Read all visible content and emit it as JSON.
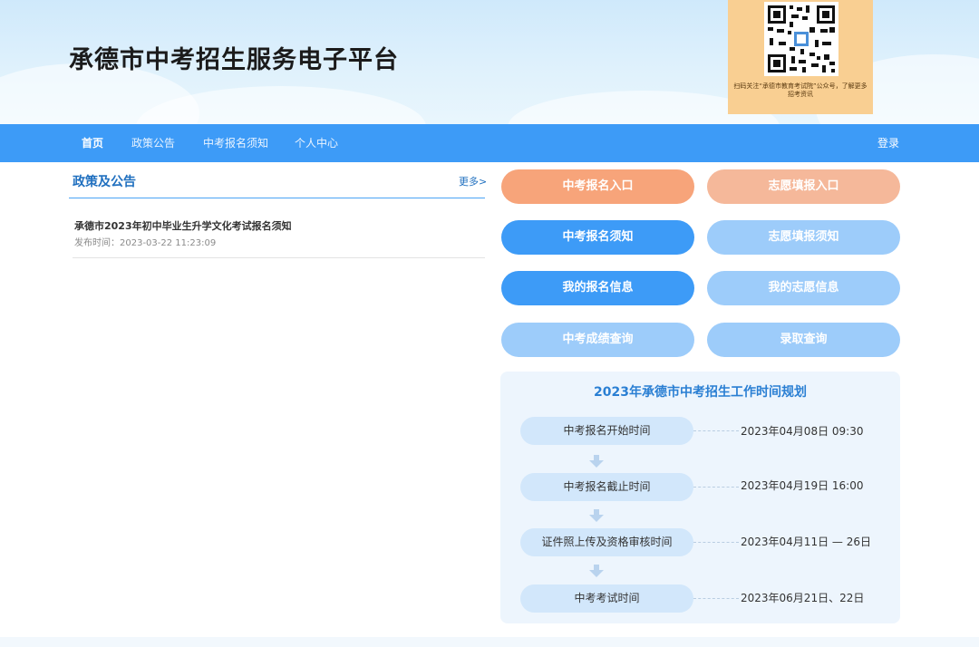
{
  "header": {
    "site_title": "承德市中考招生服务电子平台",
    "qr_caption": "扫码关注“承德市教育考试院”公众号，了解更多招考资讯"
  },
  "nav": {
    "items": [
      "首页",
      "政策公告",
      "中考报名须知",
      "个人中心"
    ],
    "login": "登录"
  },
  "notices": {
    "title": "政策及公告",
    "more": "更多>",
    "items": [
      {
        "title": "承德市2023年初中毕业生升学文化考试报名须知",
        "date": "发布时间：2023-03-22 11:23:09"
      }
    ]
  },
  "buttons": {
    "exam_signup": "中考报名入口",
    "wish_fill": "志愿填报入口",
    "exam_notice": "中考报名须知",
    "wish_notice": "志愿填报须知",
    "my_signup": "我的报名信息",
    "my_wish": "我的志愿信息",
    "score_query": "中考成绩查询",
    "admission_query": "录取查询"
  },
  "colors": {
    "orange": "#f7a47a",
    "orange_light": "#f5b89a",
    "blue": "#3d9bf7",
    "blue_light": "#9dccfa",
    "nav": "#3d9bf7"
  },
  "timeline": {
    "title": "2023年承德市中考招生工作时间规划",
    "steps": [
      {
        "label": "中考报名开始时间",
        "value": "2023年04月08日  09:30"
      },
      {
        "label": "中考报名截止时间",
        "value": "2023年04月19日  16:00"
      },
      {
        "label": "证件照上传及资格审核时间",
        "value": "2023年04月11日 — 26日"
      },
      {
        "label": "中考考试时间",
        "value": "2023年06月21日、22日"
      }
    ]
  }
}
